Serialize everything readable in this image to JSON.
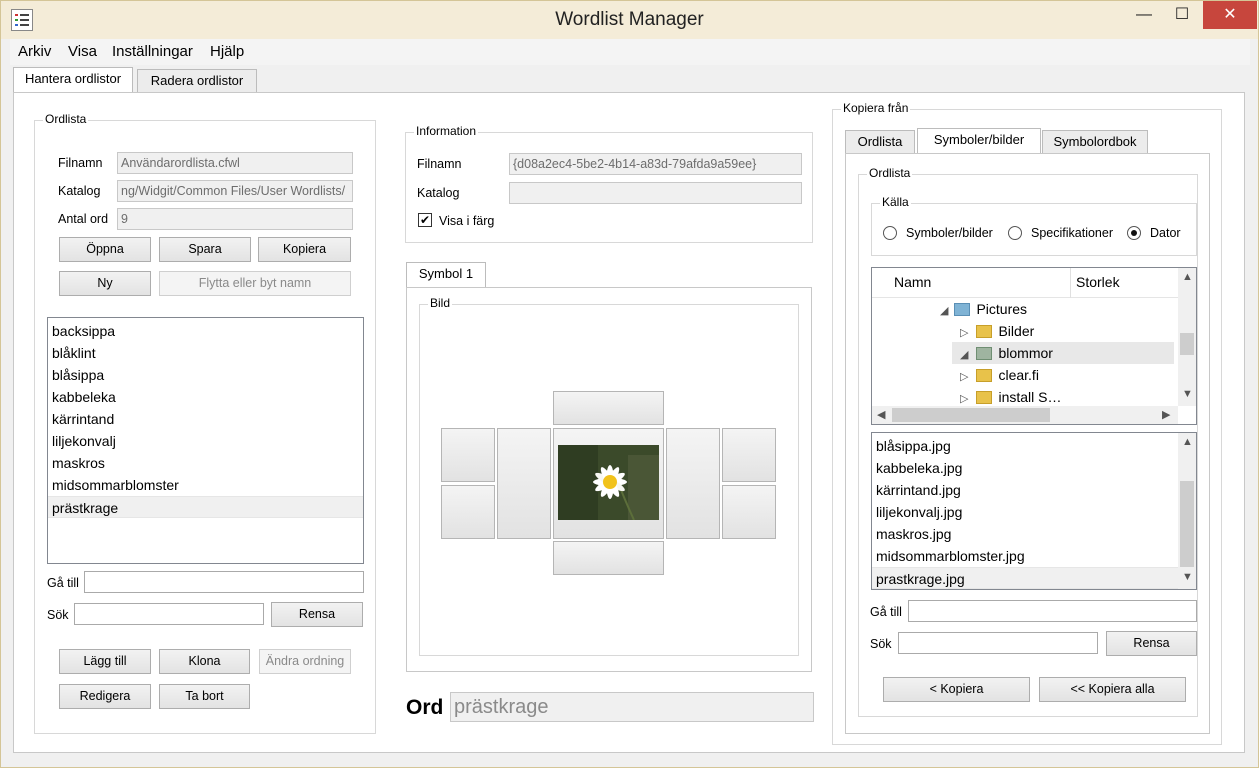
{
  "window": {
    "title": "Wordlist Manager",
    "minimize": "—",
    "maximize": "☐",
    "close": "✕"
  },
  "menu": [
    "Arkiv",
    "Visa",
    "Inställningar",
    "Hjälp"
  ],
  "tabs": [
    "Hantera ordlistor",
    "Radera ordlistor"
  ],
  "ordlista": {
    "title": "Ordlista",
    "filnamn_label": "Filnamn",
    "filnamn_value": "Användarordlista.cfwl",
    "katalog_label": "Katalog",
    "katalog_value": "ng/Widgit/Common Files/User Wordlists/",
    "antal_label": "Antal ord",
    "antal_value": "9",
    "buttons": {
      "open": "Öppna",
      "save": "Spara",
      "copy": "Kopiera",
      "new": "Ny",
      "move": "Flytta eller byt namn"
    },
    "words": [
      "backsippa",
      "blåklint",
      "blåsippa",
      "kabbeleka",
      "kärrintand",
      "liljekonvalj",
      "maskros",
      "midsommarblomster",
      "prästkrage"
    ],
    "goto_label": "Gå till",
    "search_label": "Sök",
    "clear": "Rensa",
    "actions": {
      "add": "Lägg till",
      "clone": "Klona",
      "reorder": "Ändra ordning",
      "edit": "Redigera",
      "delete": "Ta bort"
    }
  },
  "info": {
    "title": "Information",
    "filnamn_label": "Filnamn",
    "filnamn_value": "{d08a2ec4-5be2-4b14-a83d-79afda9a59ee}",
    "katalog_label": "Katalog",
    "katalog_value": "",
    "color_label": "Visa i färg",
    "color_checked": "✔"
  },
  "symbol": {
    "tab": "Symbol 1",
    "image_group": "Bild",
    "word_label": "Ord",
    "word_value": "prästkrage"
  },
  "copy_from": {
    "title": "Kopiera från",
    "tabs": [
      "Ordlista",
      "Symboler/bilder",
      "Symbolordbok"
    ],
    "inner_title": "Ordlista",
    "source_title": "Källa",
    "sources": [
      "Symboler/bilder",
      "Specifikationer",
      "Dator"
    ],
    "tree_headers": {
      "name": "Namn",
      "size": "Storlek"
    },
    "tree": [
      "Pictures",
      "Bilder",
      "blommor",
      "clear.fi",
      "install S…"
    ],
    "files": [
      "blåsippa.jpg",
      "kabbeleka.jpg",
      "kärrintand.jpg",
      "liljekonvalj.jpg",
      "maskros.jpg",
      "midsommarblomster.jpg",
      "prastkrage.jpg"
    ],
    "goto_label": "Gå till",
    "search_label": "Sök",
    "clear": "Rensa",
    "copy": "< Kopiera",
    "copy_all": "<< Kopiera alla"
  }
}
